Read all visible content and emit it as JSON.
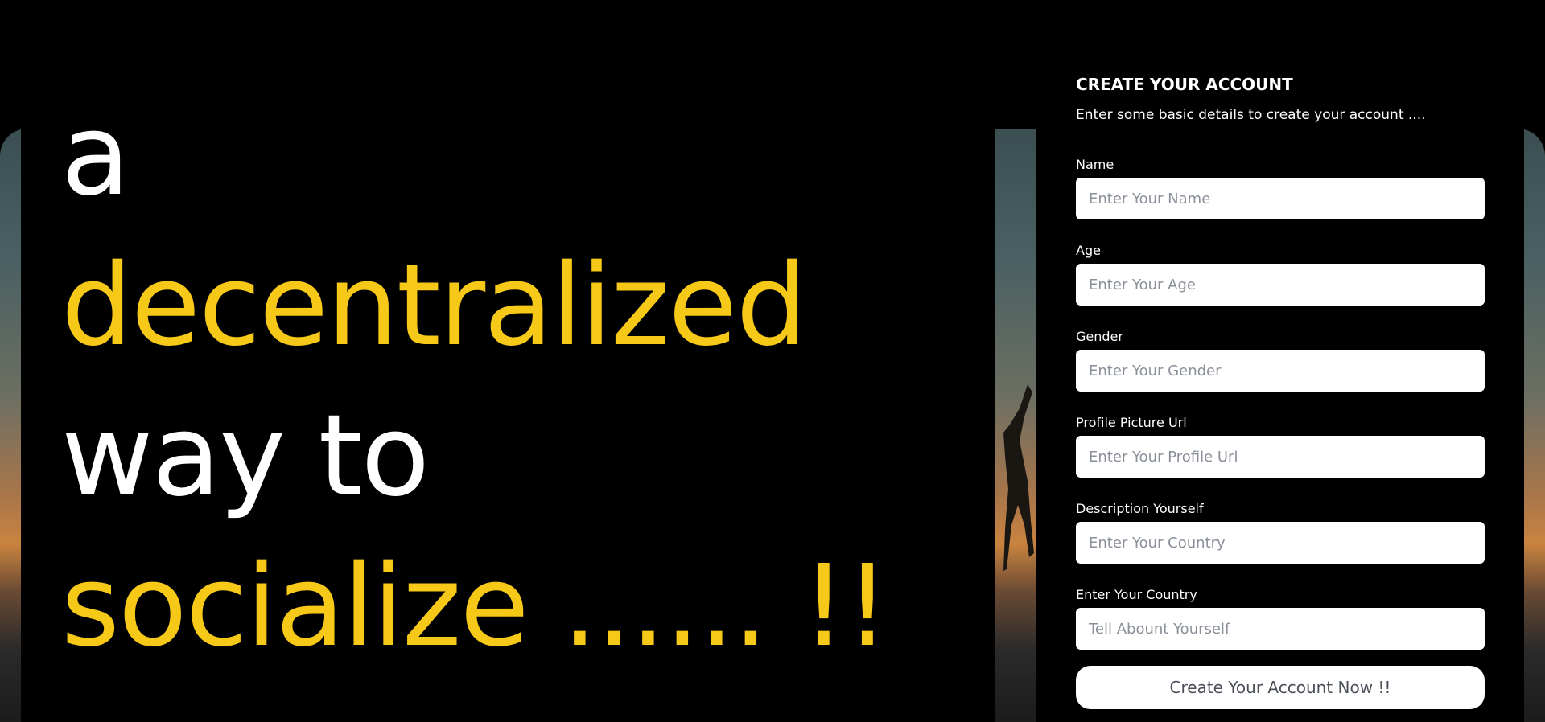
{
  "hero": {
    "line1": "a",
    "line2": "decentralized",
    "line3": "way to",
    "line4": "socialize ...... !!"
  },
  "form": {
    "title": "CREATE YOUR ACCOUNT",
    "subtitle": "Enter some basic details to create your account ....",
    "fields": [
      {
        "label": "Name",
        "placeholder": "Enter Your Name"
      },
      {
        "label": "Age",
        "placeholder": "Enter Your Age"
      },
      {
        "label": "Gender",
        "placeholder": "Enter Your Gender"
      },
      {
        "label": "Profile Picture Url",
        "placeholder": "Enter Your Profile Url"
      },
      {
        "label": "Description Yourself",
        "placeholder": "Enter Your Country"
      },
      {
        "label": "Enter Your Country",
        "placeholder": "Tell Abount Yourself"
      }
    ],
    "submit_label": "Create Your Account Now !!"
  },
  "colors": {
    "accent": "#f6c817",
    "background": "#000000",
    "text": "#ffffff"
  }
}
